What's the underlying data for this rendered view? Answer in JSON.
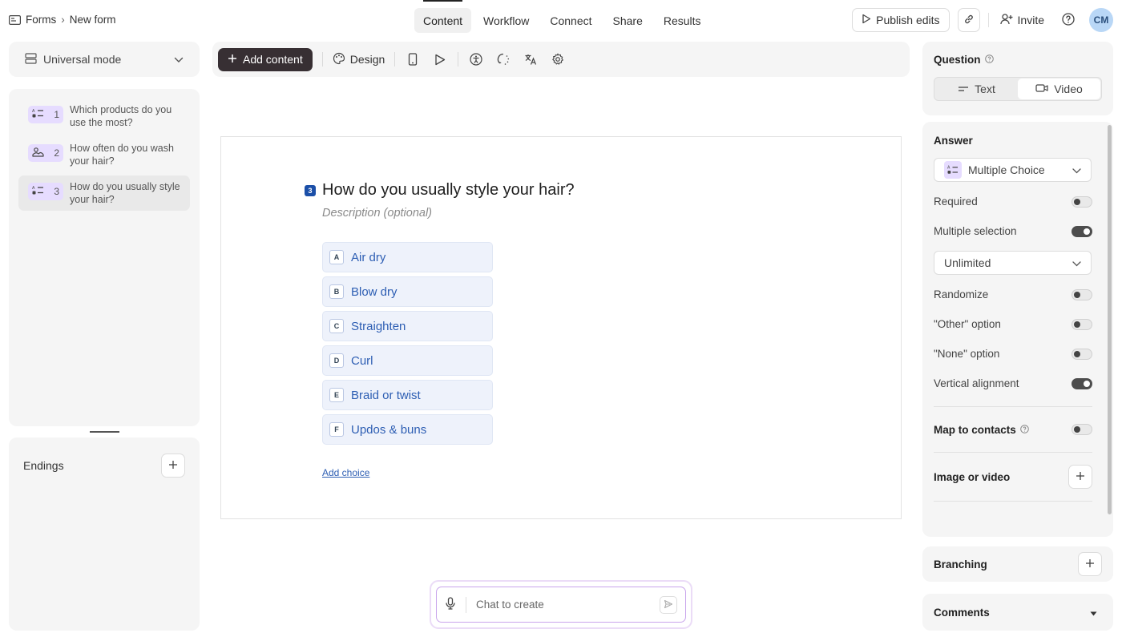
{
  "breadcrumb": {
    "root": "Forms",
    "separator": "›",
    "current": "New form"
  },
  "nav": {
    "tabs": [
      {
        "label": "Content",
        "active": true
      },
      {
        "label": "Workflow",
        "active": false
      },
      {
        "label": "Connect",
        "active": false
      },
      {
        "label": "Share",
        "active": false
      },
      {
        "label": "Results",
        "active": false
      }
    ]
  },
  "header": {
    "publish_label": "Publish edits",
    "invite_label": "Invite",
    "avatar_initials": "CM"
  },
  "mode": {
    "label": "Universal mode"
  },
  "questions": [
    {
      "number": "1",
      "text": "Which products do you use the most?",
      "icon": "list-icon",
      "selected": false
    },
    {
      "number": "2",
      "text": "How often do you wash your hair?",
      "icon": "image-icon",
      "selected": false
    },
    {
      "number": "3",
      "text": "How do you usually style your hair?",
      "icon": "list-icon",
      "selected": true
    }
  ],
  "endings": {
    "label": "Endings"
  },
  "toolbar": {
    "add_content_label": "Add content",
    "design_label": "Design",
    "icons": [
      "mobile-preview-icon",
      "play-icon",
      "accessibility-icon",
      "loading-icon",
      "translate-icon",
      "settings-icon"
    ]
  },
  "canvas": {
    "question_number": "3",
    "title": "How do you usually style your hair?",
    "description_placeholder": "Description (optional)",
    "choices": [
      {
        "key": "A",
        "label": "Air dry"
      },
      {
        "key": "B",
        "label": "Blow dry"
      },
      {
        "key": "C",
        "label": "Straighten"
      },
      {
        "key": "D",
        "label": "Curl"
      },
      {
        "key": "E",
        "label": "Braid or twist"
      },
      {
        "key": "F",
        "label": "Updos & buns"
      }
    ],
    "add_choice_label": "Add choice"
  },
  "chat": {
    "placeholder": "Chat to create"
  },
  "right": {
    "question_title": "Question",
    "segments": {
      "text": "Text",
      "video": "Video"
    },
    "answer_title": "Answer",
    "answer_type": "Multiple Choice",
    "required_label": "Required",
    "multiple_selection_label": "Multiple selection",
    "limit_value": "Unlimited",
    "randomize_label": "Randomize",
    "other_option_label": "\"Other\" option",
    "none_option_label": "\"None\" option",
    "vertical_alignment_label": "Vertical alignment",
    "map_contacts_label": "Map to contacts",
    "image_video_label": "Image or video",
    "branching_label": "Branching",
    "comments_label": "Comments",
    "toggles": {
      "required": false,
      "multiple_selection": true,
      "randomize": false,
      "other_option": false,
      "none_option": false,
      "vertical_alignment": true,
      "map_contacts": false
    }
  },
  "colors": {
    "accent_dark": "#372f33",
    "choice_text": "#2d5eb3",
    "badge_purple": "#e6dcff",
    "question_number_bg": "#1b4fa8"
  }
}
